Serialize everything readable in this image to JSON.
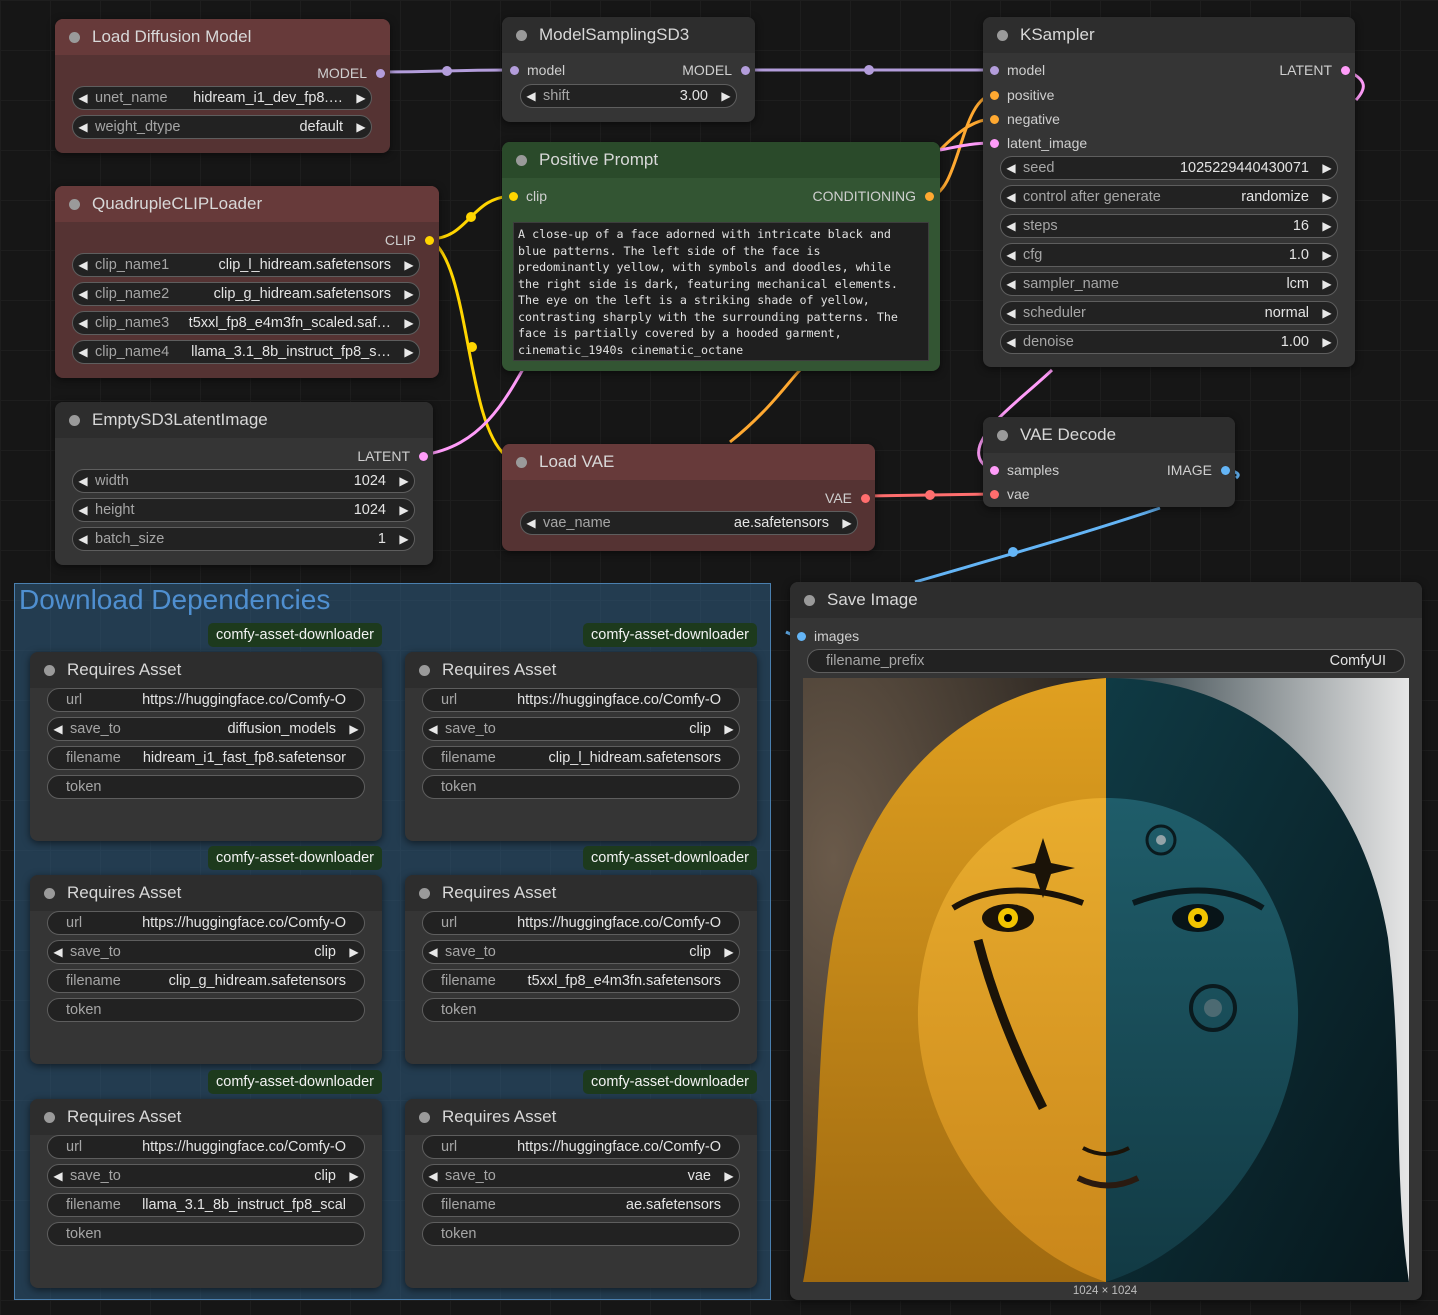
{
  "colors": {
    "model": "#b39ddb",
    "clip": "#ffd500",
    "conditioning": "#ffa931",
    "latent": "#ff9cf9",
    "vae": "#ff6e6e",
    "image": "#64b5f6"
  },
  "nodes": {
    "load_diffusion": {
      "title": "Load Diffusion Model",
      "out": "MODEL",
      "w_unet_label": "unet_name",
      "w_unet_value": "hidream_i1_dev_fp8.…",
      "w_dtype_label": "weight_dtype",
      "w_dtype_value": "default"
    },
    "model_sampling": {
      "title": "ModelSamplingSD3",
      "in": "model",
      "out": "MODEL",
      "w_shift_label": "shift",
      "w_shift_value": "3.00"
    },
    "ksampler": {
      "title": "KSampler",
      "in_model": "model",
      "in_positive": "positive",
      "in_negative": "negative",
      "in_latent": "latent_image",
      "out": "LATENT",
      "widgets": [
        {
          "label": "seed",
          "value": "1025229440430071"
        },
        {
          "label": "control after generate",
          "value": "randomize"
        },
        {
          "label": "steps",
          "value": "16"
        },
        {
          "label": "cfg",
          "value": "1.0"
        },
        {
          "label": "sampler_name",
          "value": "lcm"
        },
        {
          "label": "scheduler",
          "value": "normal"
        },
        {
          "label": "denoise",
          "value": "1.00"
        }
      ]
    },
    "positive_prompt": {
      "title": "Positive Prompt",
      "in": "clip",
      "out": "CONDITIONING",
      "text": "A close-up of a face adorned with intricate black and\nblue patterns. The left side of the face is\npredominantly yellow, with symbols and doodles, while\nthe right side is dark, featuring mechanical elements.\nThe eye on the left is a striking shade of yellow,\ncontrasting sharply with the surrounding patterns. The\nface is partially covered by a hooded garment,\ncinematic_1940s cinematic_octane"
    },
    "quad_clip": {
      "title": "QuadrupleCLIPLoader",
      "out": "CLIP",
      "widgets": [
        {
          "label": "clip_name1",
          "value": "clip_l_hidream.safetensors"
        },
        {
          "label": "clip_name2",
          "value": "clip_g_hidream.safetensors"
        },
        {
          "label": "clip_name3",
          "value": "t5xxl_fp8_e4m3fn_scaled.saf…"
        },
        {
          "label": "clip_name4",
          "value": "llama_3.1_8b_instruct_fp8_s…"
        }
      ]
    },
    "empty_latent": {
      "title": "EmptySD3LatentImage",
      "out": "LATENT",
      "widgets": [
        {
          "label": "width",
          "value": "1024"
        },
        {
          "label": "height",
          "value": "1024"
        },
        {
          "label": "batch_size",
          "value": "1"
        }
      ]
    },
    "load_vae": {
      "title": "Load VAE",
      "out": "VAE",
      "w_label": "vae_name",
      "w_value": "ae.safetensors"
    },
    "vae_decode": {
      "title": "VAE Decode",
      "in_samples": "samples",
      "in_vae": "vae",
      "out": "IMAGE"
    },
    "save_image": {
      "title": "Save Image",
      "in": "images",
      "w_label": "filename_prefix",
      "w_value": "ComfyUI",
      "footer": "1024 × 1024"
    }
  },
  "group": {
    "title": "Download Dependencies",
    "tag": "comfy-asset-downloader",
    "node_title": "Requires Asset",
    "labels": {
      "url": "url",
      "save_to": "save_to",
      "filename": "filename",
      "token": "token"
    },
    "assets": [
      {
        "url": "https://huggingface.co/Comfy-O",
        "save_to": "diffusion_models",
        "filename": "hidream_i1_fast_fp8.safetensor"
      },
      {
        "url": "https://huggingface.co/Comfy-O",
        "save_to": "clip",
        "filename": "clip_l_hidream.safetensors"
      },
      {
        "url": "https://huggingface.co/Comfy-O",
        "save_to": "clip",
        "filename": "clip_g_hidream.safetensors"
      },
      {
        "url": "https://huggingface.co/Comfy-O",
        "save_to": "clip",
        "filename": "t5xxl_fp8_e4m3fn.safetensors"
      },
      {
        "url": "https://huggingface.co/Comfy-O",
        "save_to": "clip",
        "filename": "llama_3.1_8b_instruct_fp8_scal"
      },
      {
        "url": "https://huggingface.co/Comfy-O",
        "save_to": "vae",
        "filename": "ae.safetensors"
      }
    ]
  }
}
